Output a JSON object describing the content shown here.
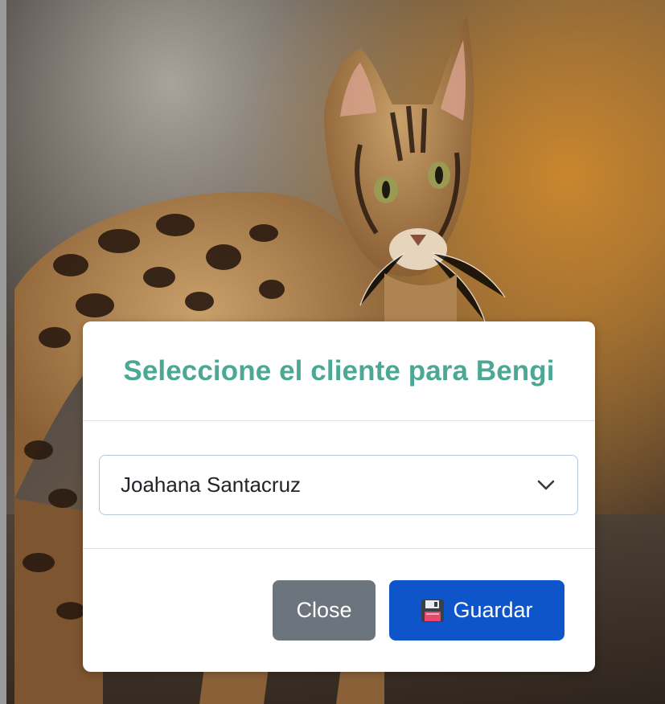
{
  "modal": {
    "title": "Seleccione el cliente para Bengi",
    "select": {
      "selected": "Joahana Santacruz"
    },
    "footer": {
      "close_label": "Close",
      "save_label": "Guardar"
    }
  },
  "icons": {
    "select_arrow": "chevron-down-icon",
    "save": "floppy-disk-icon"
  },
  "colors": {
    "title": "#4aa894",
    "save_button": "#0d55c9",
    "close_button": "#6c757d"
  }
}
